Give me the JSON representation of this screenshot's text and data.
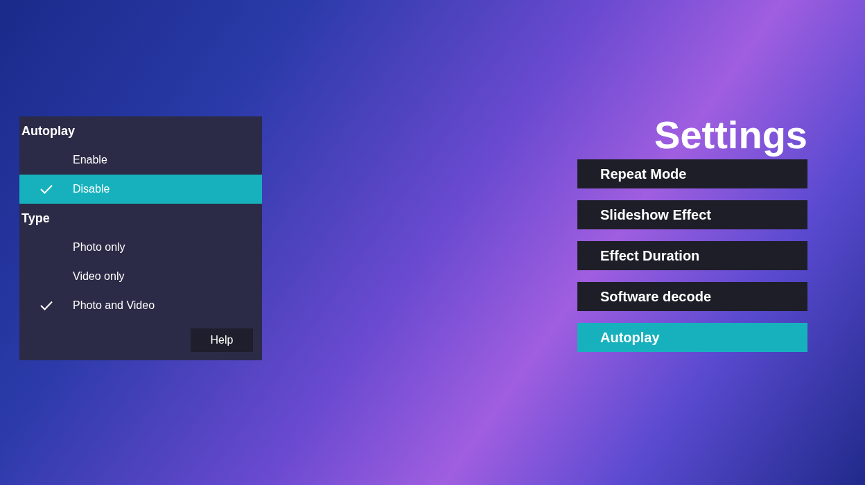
{
  "option_panel": {
    "sections": [
      {
        "title": "Autoplay",
        "options": [
          {
            "label": "Enable",
            "checked": false,
            "selected": false
          },
          {
            "label": "Disable",
            "checked": true,
            "selected": true
          }
        ]
      },
      {
        "title": "Type",
        "options": [
          {
            "label": "Photo only",
            "checked": false,
            "selected": false
          },
          {
            "label": "Video only",
            "checked": false,
            "selected": false
          },
          {
            "label": "Photo and Video",
            "checked": true,
            "selected": false
          }
        ]
      }
    ],
    "help_button": "Help"
  },
  "settings": {
    "title": "Settings",
    "items": [
      {
        "label": "Repeat Mode",
        "selected": false
      },
      {
        "label": "Slideshow Effect",
        "selected": false
      },
      {
        "label": "Effect Duration",
        "selected": false
      },
      {
        "label": "Software decode",
        "selected": false
      },
      {
        "label": "Autoplay",
        "selected": true
      }
    ]
  }
}
